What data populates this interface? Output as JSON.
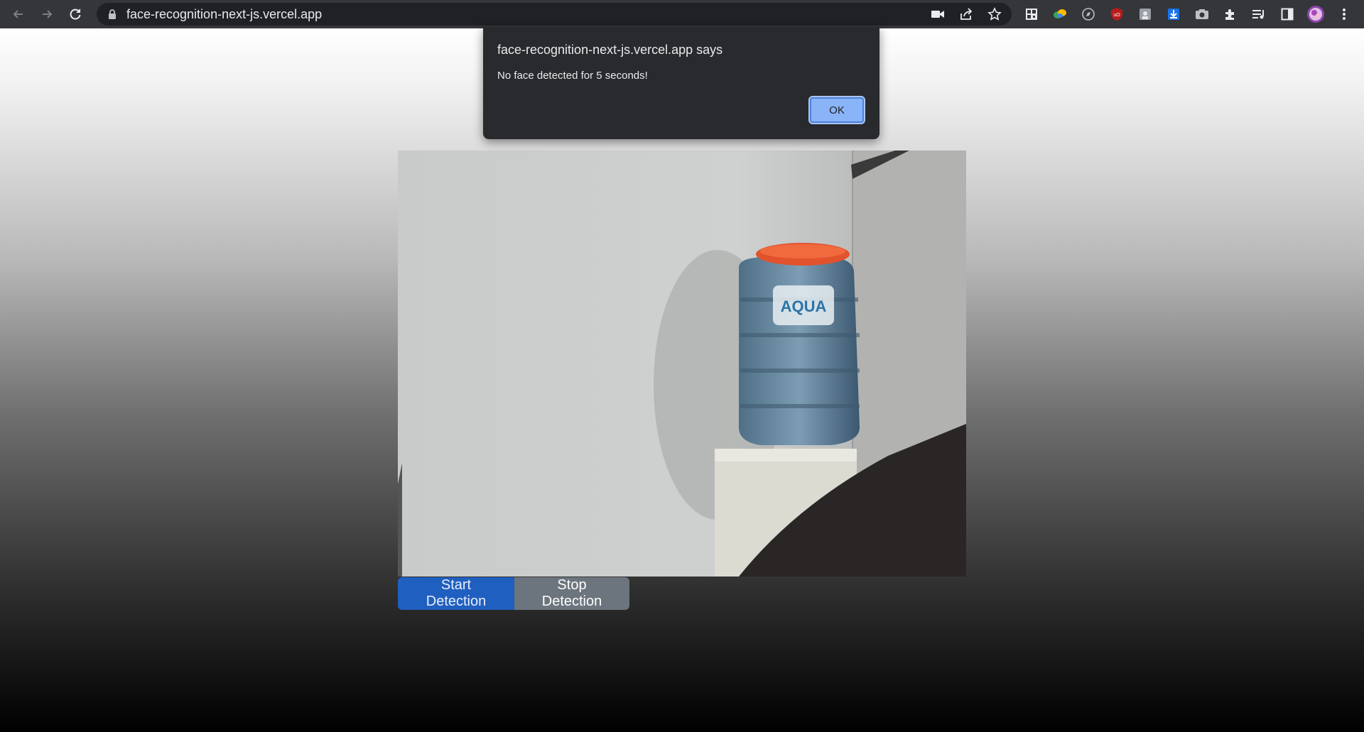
{
  "browser": {
    "url": "face-recognition-next-js.vercel.app"
  },
  "dialog": {
    "title": "face-recognition-next-js.vercel.app says",
    "message": "No face detected for 5 seconds!",
    "ok_label": "OK"
  },
  "page": {
    "start_label": "Start Detection",
    "stop_label": "Stop Detection",
    "camera_label_text": "AQUA"
  },
  "colors": {
    "start_button": "#1f5fbf",
    "stop_button": "#6c757d",
    "dialog_bg": "#292a2d",
    "ok_button": "#8ab4f8"
  }
}
